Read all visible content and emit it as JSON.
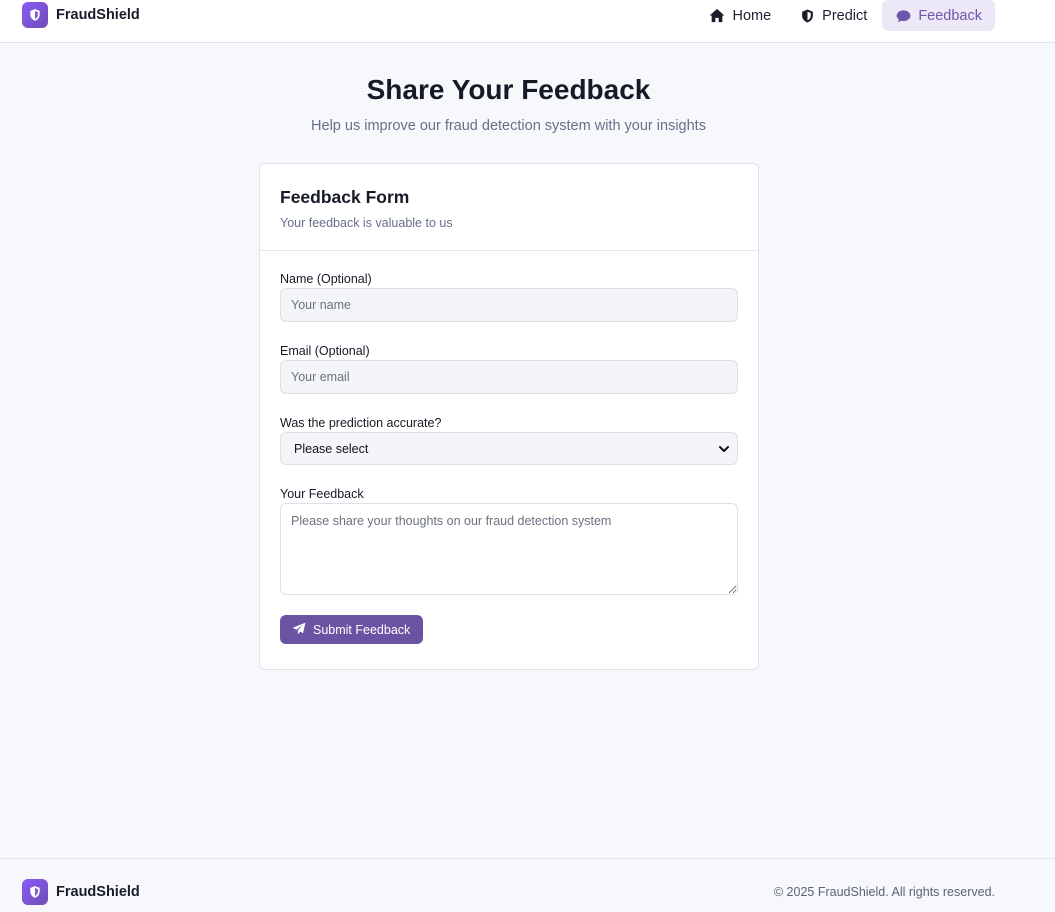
{
  "brand": {
    "name": "FraudShield",
    "icon": "shield-icon"
  },
  "nav": {
    "items": [
      {
        "label": "Home",
        "icon": "home-icon",
        "active": false
      },
      {
        "label": "Predict",
        "icon": "shield-half-icon",
        "active": false
      },
      {
        "label": "Feedback",
        "icon": "chat-bubble-icon",
        "active": true
      }
    ]
  },
  "hero": {
    "title": "Share Your Feedback",
    "subtitle": "Help us improve our fraud detection system with your insights"
  },
  "form": {
    "title": "Feedback Form",
    "description": "Your feedback is valuable to us",
    "name_label": "Name (Optional)",
    "name_placeholder": "Your name",
    "email_label": "Email (Optional)",
    "email_placeholder": "Your email",
    "accuracy_label": "Was the prediction accurate?",
    "accuracy_selected": "Please select",
    "feedback_label": "Your Feedback",
    "feedback_placeholder": "Please share your thoughts on our fraud detection system",
    "submit_label": "Submit Feedback",
    "submit_icon": "paper-plane-icon"
  },
  "footer": {
    "brand_name": "FraudShield",
    "copyright": "© 2025 FraudShield. All rights reserved."
  },
  "colors": {
    "accent": "#6b52a3",
    "active_nav_bg": "#ede8f8",
    "page_bg": "#f7f8fb"
  }
}
